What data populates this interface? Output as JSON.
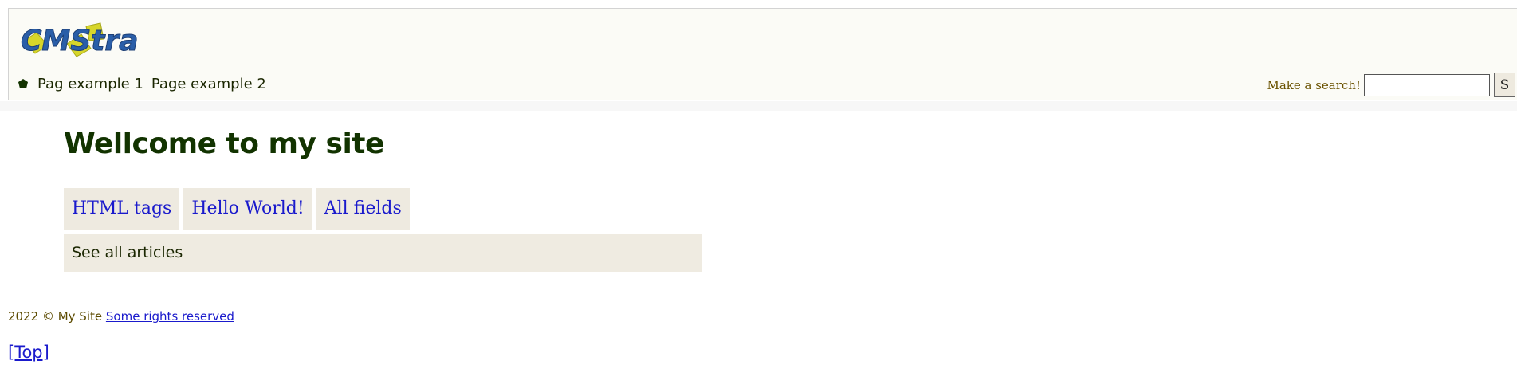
{
  "header": {
    "logo_text": "CMStra",
    "nav": [
      {
        "label": "Pag example 1"
      },
      {
        "label": "Page example 2"
      }
    ],
    "search": {
      "label": "Make a search!",
      "value": "",
      "button_label": "S"
    }
  },
  "main": {
    "title": "Wellcome to my site",
    "tags": [
      {
        "label": "HTML tags"
      },
      {
        "label": "Hello World!"
      },
      {
        "label": "All fields"
      }
    ],
    "see_all_label": "See all articles"
  },
  "footer": {
    "copyright": "2022 © My Site",
    "rights_link": "Some rights reserved",
    "top_link": "[Top]"
  },
  "colors": {
    "logo_blue": "#2a5ea8",
    "logo_yellow": "#d7d62a",
    "heading_green": "#123300",
    "link_blue": "#1a1acc"
  }
}
